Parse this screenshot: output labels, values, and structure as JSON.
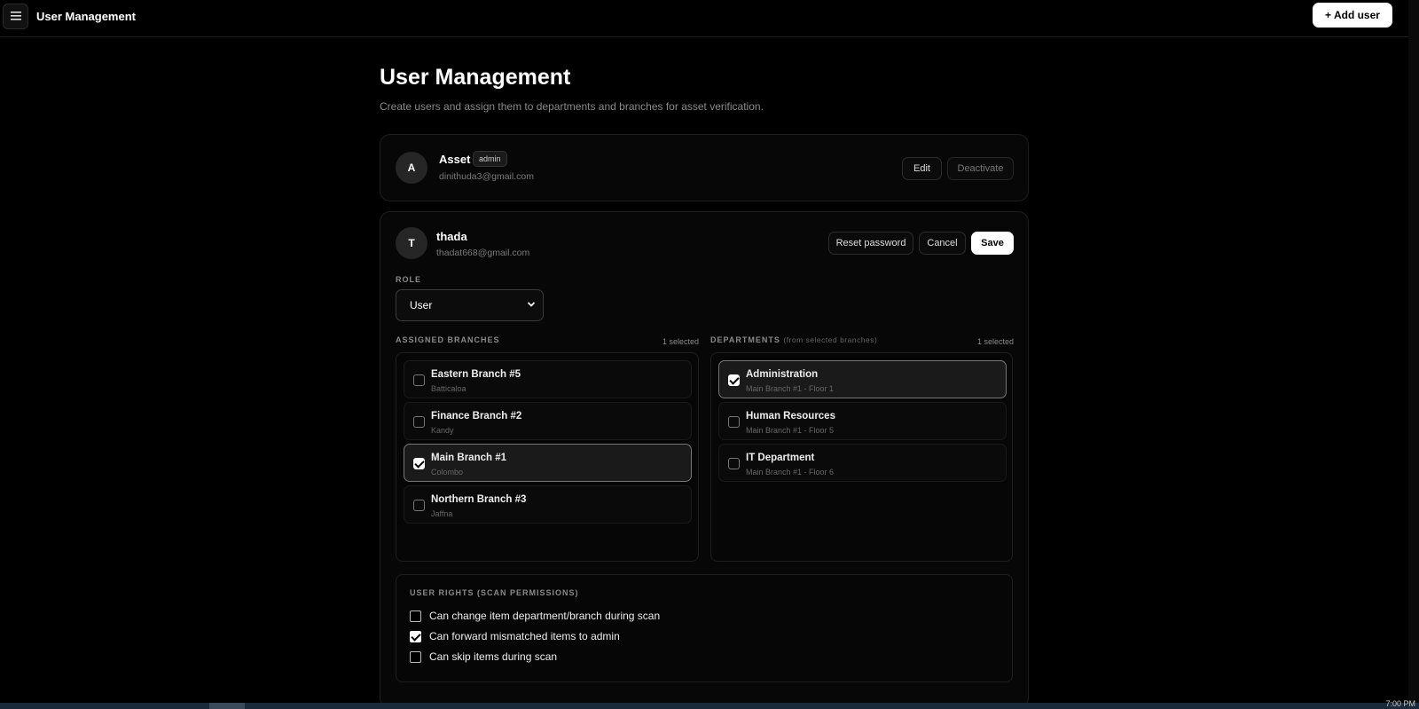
{
  "topbar": {
    "title": "User Management",
    "add_user_label": "+ Add user"
  },
  "page": {
    "title": "User Management",
    "subtitle": "Create users and assign them to departments and branches for asset verification."
  },
  "users": [
    {
      "initial": "A",
      "name": "Asset",
      "badge": "admin",
      "email": "dinithuda3@gmail.com",
      "edit_label": "Edit",
      "deactivate_label": "Deactivate"
    },
    {
      "initial": "T",
      "name": "thada",
      "email": "thadat668@gmail.com",
      "reset_label": "Reset password",
      "cancel_label": "Cancel",
      "save_label": "Save"
    }
  ],
  "editor": {
    "role_label": "ROLE",
    "role_value": "User",
    "branches_label": "ASSIGNED BRANCHES",
    "branches_count": "1 selected",
    "departments_label": "DEPARTMENTS",
    "departments_sublabel": "(from selected branches)",
    "departments_count": "1 selected",
    "branches": [
      {
        "name": "Eastern Branch #5",
        "location": "Batticaloa",
        "checked": false
      },
      {
        "name": "Finance Branch #2",
        "location": "Kandy",
        "checked": false
      },
      {
        "name": "Main Branch #1",
        "location": "Colombo",
        "checked": true
      },
      {
        "name": "Northern Branch #3",
        "location": "Jaffna",
        "checked": false
      }
    ],
    "departments": [
      {
        "name": "Administration",
        "location": "Main Branch #1 - Floor 1",
        "checked": true
      },
      {
        "name": "Human Resources",
        "location": "Main Branch #1 - Floor 5",
        "checked": false
      },
      {
        "name": "IT Department",
        "location": "Main Branch #1 - Floor 6",
        "checked": false
      }
    ],
    "rights_label": "USER RIGHTS (SCAN PERMISSIONS)",
    "rights": [
      {
        "label": "Can change item department/branch during scan",
        "checked": false
      },
      {
        "label": "Can forward mismatched items to admin",
        "checked": true
      },
      {
        "label": "Can skip items during scan",
        "checked": false
      }
    ]
  },
  "taskbar": {
    "time": "7:00 PM"
  }
}
